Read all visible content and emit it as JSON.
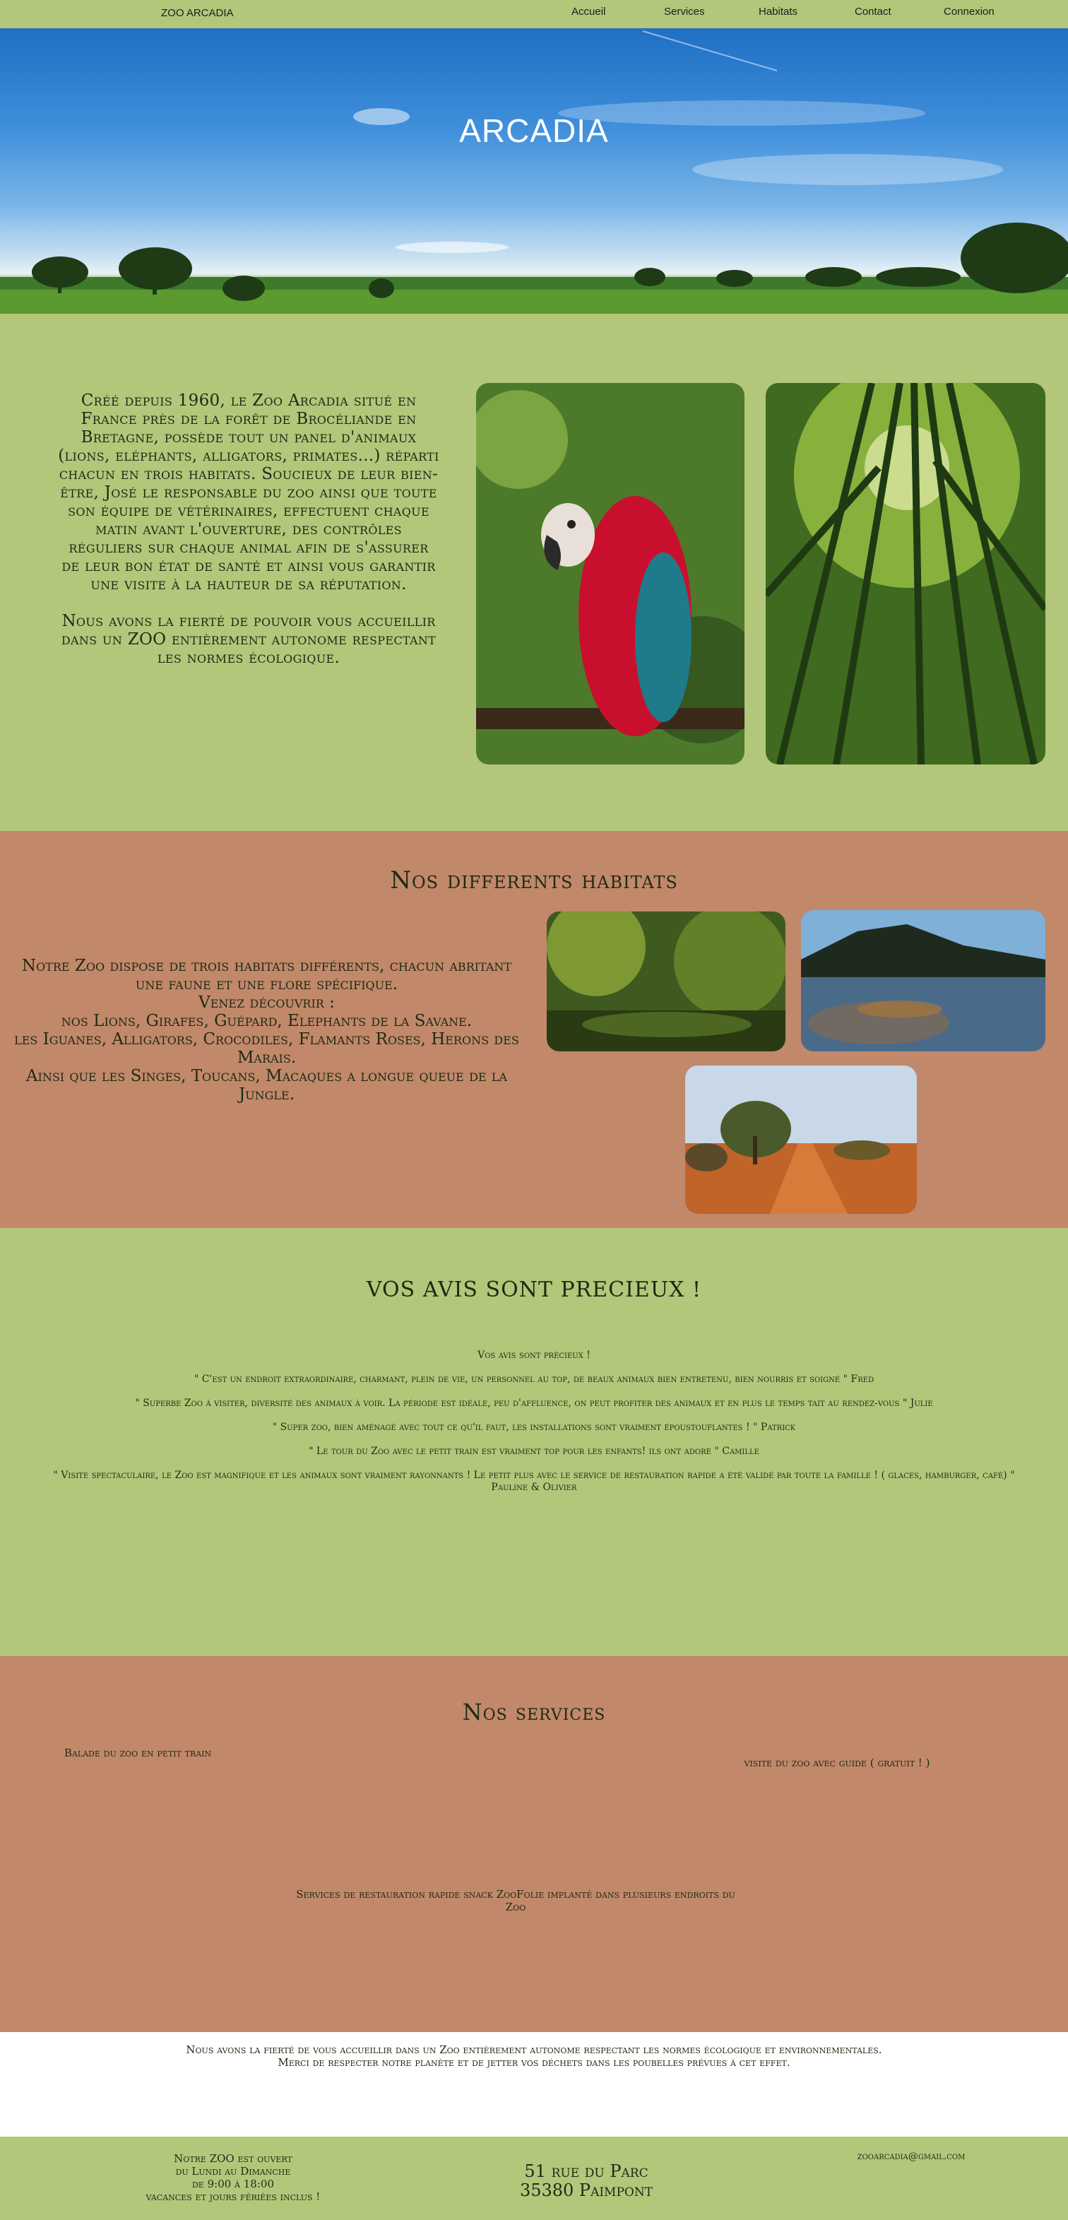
{
  "nav": {
    "brand": "ZOO ARCADIA",
    "links": [
      "Accueil",
      "Services",
      "Habitats",
      "Contact",
      "Connexion"
    ]
  },
  "hero": {
    "title": "ARCADIA"
  },
  "about": {
    "paragraph1": "Créé depuis 1960, le Zoo Arcadia situé en France près de la forêt de Brocéliande en Bretagne, possède tout un panel d'animaux (lions, eléphants, alligators, primates...) réparti chacun en trois habitats. Soucieux de leur bien-être, José le responsable du zoo ainsi que toute son équipe de vétérinaires, effectuent chaque matin avant l'ouverture, des contrôles réguliers sur chaque animal afin de s'assurer de leur bon état de santé et ainsi vous garantir une visite à la hauteur de sa réputation.",
    "paragraph2": "Nous avons la fierté de pouvoir vous accueillir dans un ZOO entièrement autonome respectant les normes écologique."
  },
  "habitats": {
    "title": "Nos differents habitats",
    "intro": "Notre Zoo dispose de trois habitats différents, chacun abritant une faune et une flore spécifique.",
    "discover": "Venez découvrir :",
    "line1": "nos Lions, Girafes, Guépard, Elephants de la Savane.",
    "line2": "les Iguanes, Alligators, Crocodiles, Flamants Roses, Herons des Marais.",
    "line3": "Ainsi que les Singes, Toucans, Macaques a longue queue de la Jungle."
  },
  "avis": {
    "title": "VOS AVIS SONT PRECIEUX !",
    "subtitle": "Vos avis sont précieux !",
    "reviews": [
      "\" C'est un endroit extraordinaire, charmant, plein de vie, un personnel au top, de beaux animaux bien entretenu, bien nourris et soigné \" Fred",
      "\" Superbe Zoo à visiter, diversité des animaux à voir. La période est idéale, peu d'affluence, on peut profiter des animaux et en plus le temps tait au rendez-vous \" Julie",
      "\" Super zoo, bien aménagé avec tout ce qu'il faut, les installations sont vraiment époustouflantes ! \" Patrick",
      "\" Le tour du Zoo avec le petit train est vraiment top pour les enfants! ils ont adoré \" Camille",
      "\" Visite spectaculaire, le Zoo est magnifique et les animaux sont vraiment rayonnants ! Le petit plus avec le service de restauration rapide a été validé par toute la famille ! ( glaces, hamburger, café) \" Pauline & Olivier"
    ]
  },
  "services": {
    "title": "Nos services",
    "train": "Balade du zoo en petit train",
    "guide": "visite du zoo avec guide ( gratuit ! )",
    "food": "Services de restauration rapide snack ZooFolie implanté dans plusieurs endroits du Zoo"
  },
  "eco": {
    "line1": "Nous avons la fierté de vous accueillir dans un Zoo entièrement autonome respectant les normes écologique et environnementales.",
    "line2": "Merci de respecter notre planète et de jetter vos déchets dans les poubelles prévues à cet effet."
  },
  "footer": {
    "hours": [
      "Notre ZOO est ouvert",
      "du Lundi au Dimanche",
      "de 9:00 à 18:00",
      "vacances et jours fériées inclus !"
    ],
    "address": [
      "51 rue du Parc",
      "35380 Paimpont"
    ],
    "email": "zooarcadia@gmail.com"
  },
  "colors": {
    "green": "#b2c77a",
    "terracotta": "#c1886a"
  }
}
